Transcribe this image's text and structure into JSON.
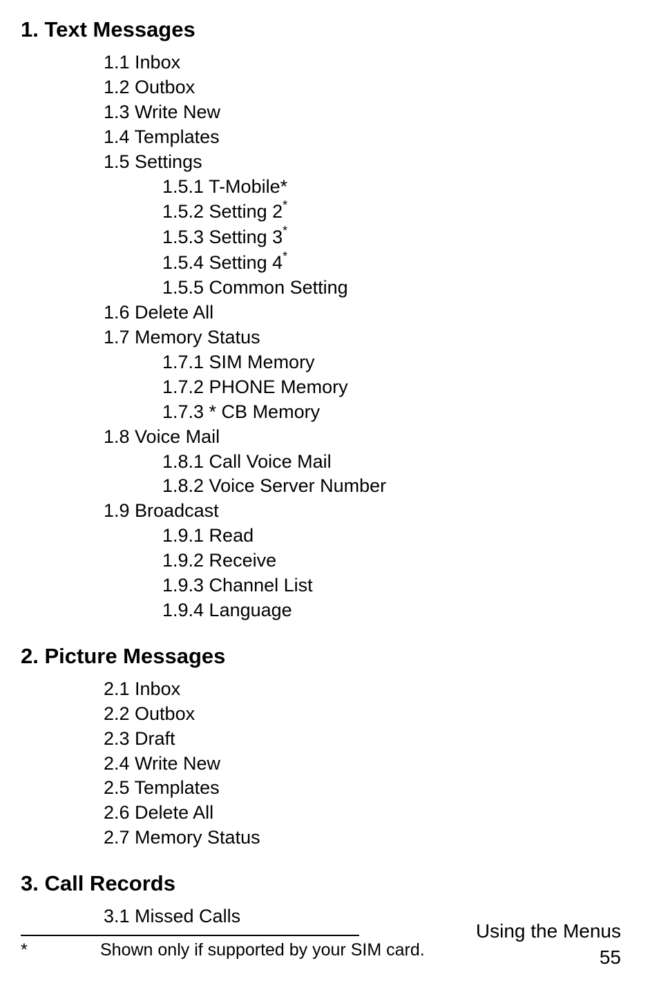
{
  "sections": {
    "s1": {
      "heading": "1.  Text Messages",
      "i1": "1.1  Inbox",
      "i2": "1.2  Outbox",
      "i3": "1.3  Write New",
      "i4": "1.4  Templates",
      "i5": "1.5  Settings",
      "s51": "1.5.1 T-Mobile*",
      "s52": "1.5.2 Setting 2",
      "s53": "1.5.3 Setting 3",
      "s54": "1.5.4 Setting 4",
      "s55": "1.5.5 Common Setting",
      "i6": "1.6 Delete All",
      "i7": "1.7 Memory Status",
      "s71": "1.7.1  SIM Memory",
      "s72": "1.7.2  PHONE Memory",
      "s73": "1.7.3 * CB Memory",
      "i8": "1.8  Voice Mail",
      "s81": "1.8.1  Call Voice Mail",
      "s82": "1.8.2  Voice Server Number",
      "i9": "1.9  Broadcast",
      "s91": "1.9.1 Read",
      "s92": "1.9.2 Receive",
      "s93": "1.9.3 Channel List",
      "s94": "1.9.4 Language"
    },
    "s2": {
      "heading": "2.  Picture Messages",
      "i1": "2.1 Inbox",
      "i2": "2.2 Outbox",
      "i3": "2.3 Draft",
      "i4": "2.4 Write New",
      "i5": "2.5 Templates",
      "i6": "2.6 Delete All",
      "i7": "2.7 Memory Status"
    },
    "s3": {
      "heading": "3.  Call Records",
      "i1": "3.1  Missed Calls"
    }
  },
  "footnote": {
    "mark": "*",
    "text": "Shown only if supported by your SIM card."
  },
  "footer": {
    "title": "Using the Menus",
    "page": "55"
  },
  "star": "*"
}
